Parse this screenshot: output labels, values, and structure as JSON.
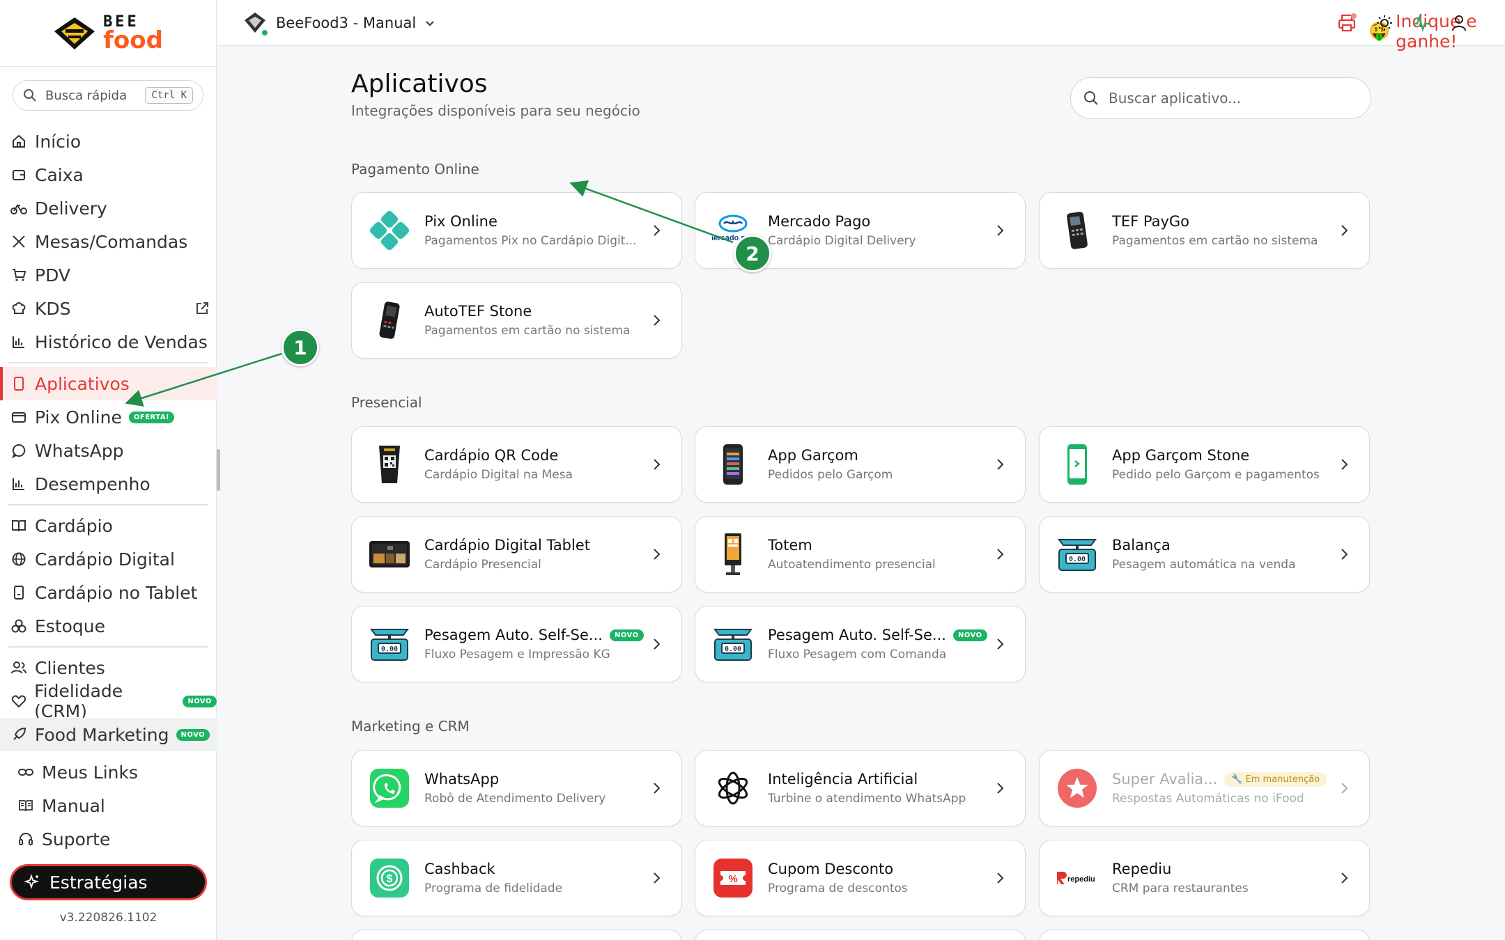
{
  "sidebar": {
    "logo": {
      "top": "BEE",
      "bottom": "food"
    },
    "quick_search": {
      "label": "Busca rápida",
      "shortcut": "Ctrl K"
    },
    "items": [
      {
        "label": "Início",
        "icon": "home-icon"
      },
      {
        "label": "Caixa",
        "icon": "wallet-icon"
      },
      {
        "label": "Delivery",
        "icon": "bike-icon"
      },
      {
        "label": "Mesas/Comandas",
        "icon": "utensils-icon"
      },
      {
        "label": "PDV",
        "icon": "cart-icon"
      },
      {
        "label": "KDS",
        "icon": "chef-hat-icon"
      },
      {
        "label": "Histórico de Vendas",
        "icon": "bar-chart-icon"
      },
      {
        "label": "Aplicativos",
        "icon": "tablet-icon"
      },
      {
        "label": "Pix Online",
        "icon": "card-icon",
        "badge": "OFERTA!"
      },
      {
        "label": "WhatsApp",
        "icon": "chat-icon"
      },
      {
        "label": "Desempenho",
        "icon": "bar-chart-icon"
      },
      {
        "label": "Cardápio",
        "icon": "book-icon"
      },
      {
        "label": "Cardápio Digital",
        "icon": "globe-icon"
      },
      {
        "label": "Cardápio no Tablet",
        "icon": "tablet-icon"
      },
      {
        "label": "Estoque",
        "icon": "boxes-icon"
      },
      {
        "label": "Clientes",
        "icon": "users-icon"
      },
      {
        "label": "Fidelidade (CRM)",
        "icon": "heart-icon",
        "badge": "NOVO"
      },
      {
        "label": "Food Marketing",
        "icon": "rocket-icon",
        "badge": "NOVO"
      },
      {
        "label": "Meus Links",
        "icon": "link-icon"
      },
      {
        "label": "Manual",
        "icon": "open-book-icon"
      },
      {
        "label": "Suporte",
        "icon": "headset-icon"
      }
    ],
    "strategies_label": "Estratégias",
    "version": "v3.220826.1102"
  },
  "topbar": {
    "store_name": "BeeFood3 - Manual",
    "indique_label": "Indique e ganhe!",
    "indique_emoji": "🤑"
  },
  "main": {
    "title": "Aplicativos",
    "subtitle": "Integrações disponíveis para seu negócio",
    "search_placeholder": "Buscar aplicativo..."
  },
  "sections": [
    {
      "title": "Pagamento Online",
      "cards": [
        {
          "title": "Pix Online",
          "desc": "Pagamentos Pix no Cardápio Digit...",
          "icon": "pix-icon"
        },
        {
          "title": "Mercado Pago",
          "desc": "Cardápio Digital Delivery",
          "icon": "mercado-pago-icon",
          "logo_text": "mercado pago"
        },
        {
          "title": "TEF PayGo",
          "desc": "Pagamentos em cartão no sistema",
          "icon": "card-terminal-icon"
        },
        {
          "title": "AutoTEF Stone",
          "desc": "Pagamentos em cartão no sistema",
          "icon": "card-terminal-icon"
        }
      ]
    },
    {
      "title": "Presencial",
      "cards": [
        {
          "title": "Cardápio QR Code",
          "desc": "Cardápio Digital na Mesa",
          "icon": "qr-stand-icon"
        },
        {
          "title": "App Garçom",
          "desc": "Pedidos pelo Garçom",
          "icon": "phone-app-icon"
        },
        {
          "title": "App Garçom Stone",
          "desc": "Pedido pelo Garçom e pagamentos",
          "icon": "green-phone-icon"
        },
        {
          "title": "Cardápio Digital Tablet",
          "desc": "Cardápio Presencial",
          "icon": "tablet-device-icon"
        },
        {
          "title": "Totem",
          "desc": "Autoatendimento presencial",
          "icon": "kiosk-icon"
        },
        {
          "title": "Balança",
          "desc": "Pesagem automática na venda",
          "icon": "scale-icon",
          "display": "0.00"
        },
        {
          "title": "Pesagem Auto. Self-Se...",
          "desc": "Fluxo Pesagem e Impressão KG",
          "icon": "scale-icon",
          "badge": "NOVO",
          "display": "0.00"
        },
        {
          "title": "Pesagem Auto. Self-Se...",
          "desc": "Fluxo Pesagem com Comanda",
          "icon": "scale-icon",
          "badge": "NOVO",
          "display": "0.00"
        }
      ]
    },
    {
      "title": "Marketing e CRM",
      "cards": [
        {
          "title": "WhatsApp",
          "desc": "Robô de Atendimento Delivery",
          "icon": "whatsapp-icon"
        },
        {
          "title": "Inteligência Artificial",
          "desc": "Turbine o atendimento WhatsApp",
          "icon": "openai-icon"
        },
        {
          "title": "Super Avalia...",
          "desc": "Respostas Automáticas no iFood",
          "icon": "star-icon",
          "badge": "🔧 Em manutenção"
        },
        {
          "title": "Cashback",
          "desc": "Programa de fidelidade",
          "icon": "cashback-icon"
        },
        {
          "title": "Cupom Desconto",
          "desc": "Programa de descontos",
          "icon": "coupon-icon"
        },
        {
          "title": "Repediu",
          "desc": "CRM para restaurantes",
          "icon": "repediu-icon",
          "logo_text": "repediu"
        }
      ]
    }
  ],
  "annotations": {
    "first": "1",
    "second": "2"
  },
  "colors": {
    "accent": "#e53935",
    "brand_orange": "#ff5a1f",
    "green": "#1db364",
    "annotation": "#1f8f4a"
  }
}
